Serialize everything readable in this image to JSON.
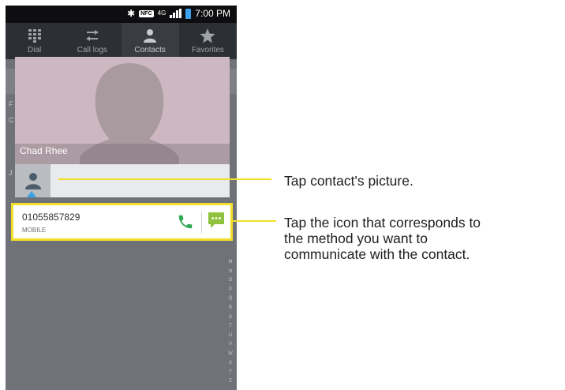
{
  "status_bar": {
    "time": "7:00 PM",
    "nfc_label": "NFC",
    "network": "4G"
  },
  "tabs": [
    {
      "label": "Dial",
      "icon": "dialpad-icon",
      "active": false
    },
    {
      "label": "Call logs",
      "icon": "call-logs-icon",
      "active": false
    },
    {
      "label": "Contacts",
      "icon": "contact-icon",
      "active": true
    },
    {
      "label": "Favorites",
      "icon": "star-icon",
      "active": false
    }
  ],
  "background_list": {
    "letters": [
      "F",
      "C",
      "J"
    ]
  },
  "index_letters": [
    "M",
    "N",
    "O",
    "P",
    "Q",
    "R",
    "S",
    "T",
    "U",
    "V",
    "W",
    "X",
    "Y",
    "Z"
  ],
  "contact_popup": {
    "name": "Chad Rhee"
  },
  "number_entry": {
    "number": "01055857829",
    "type": "MOBILE"
  },
  "callouts": {
    "picture": "Tap contact's picture.",
    "icons_line1": "Tap the icon that corresponds to",
    "icons_line2": "the method you want to",
    "icons_line3": "communicate with the contact."
  },
  "colors": {
    "highlight": "#f2df2a",
    "call_green": "#2ea84e",
    "sms_green": "#8fc23e",
    "selection_blue": "#39a3e6"
  }
}
